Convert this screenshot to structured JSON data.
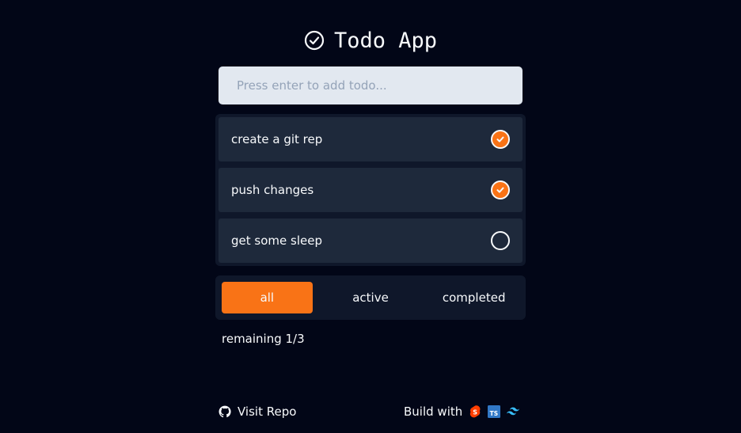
{
  "header": {
    "title": "Todo App",
    "icon": "check-circle-icon"
  },
  "input": {
    "placeholder": "Press enter to add todo...",
    "value": ""
  },
  "todos": [
    {
      "text": "create a git rep",
      "completed": true
    },
    {
      "text": "push changes",
      "completed": true
    },
    {
      "text": "get some sleep",
      "completed": false
    }
  ],
  "filters": {
    "selected": "all",
    "items": [
      {
        "label": "all"
      },
      {
        "label": "active"
      },
      {
        "label": "completed"
      }
    ]
  },
  "status": {
    "remaining": "remaining 1/3"
  },
  "footer": {
    "repo_label": "Visit Repo",
    "build_label": "Build with",
    "tech_icons": [
      "svelte-icon",
      "typescript-icon",
      "tailwind-icon"
    ],
    "tech_labels": [
      "S",
      "TS"
    ]
  },
  "colors": {
    "background": "#020617",
    "accent": "#f97316",
    "panel": "#0f172a",
    "item": "#1e293b",
    "input_bg": "#e2e8f0"
  }
}
